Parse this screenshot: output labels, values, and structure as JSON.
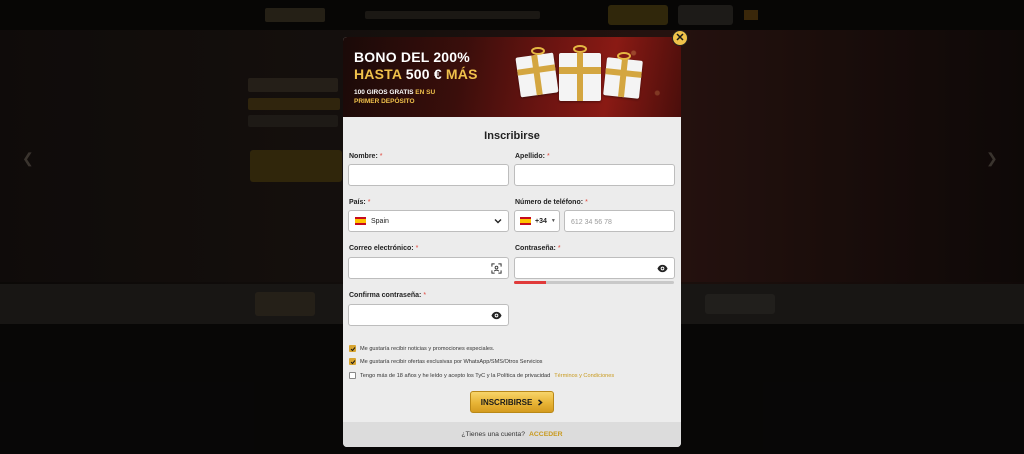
{
  "banner": {
    "title_line1": "BONO DEL 200%",
    "title_line2_prefix": "HASTA ",
    "title_line2_amount": "500 €",
    "title_line2_suffix": " MÁS",
    "sub_line1_prefix": "100 GIROS GRATIS",
    "sub_line1_suffix": " EN SU",
    "sub_line2": "PRIMER DEPÓSITO"
  },
  "close_icon": "close-icon",
  "form": {
    "title": "Inscribirse",
    "required_mark": "*",
    "first_name": {
      "label": "Nombre:",
      "value": ""
    },
    "last_name": {
      "label": "Apellido:",
      "value": ""
    },
    "country": {
      "label": "País:",
      "value": "Spain"
    },
    "phone": {
      "label": "Número de teléfono:",
      "code": "+34",
      "placeholder": "612 34 56 78"
    },
    "email": {
      "label": "Correo electrónico:",
      "value": ""
    },
    "password": {
      "label": "Contraseña:",
      "value": "",
      "strength": 0.2
    },
    "confirm_password": {
      "label": "Confirma contraseña:",
      "value": ""
    },
    "checkboxes": [
      {
        "text": "Me gustaría recibir noticias y promociones especiales.",
        "checked": true
      },
      {
        "text": "Me gustaría recibir ofertas exclusivas por WhatsApp/SMS/Otros Servicios",
        "checked": true
      },
      {
        "text": "Tengo más de 18 años y he leído y acepto los TyC y la Política de privacidad",
        "link": "Términos y Condiciones",
        "checked": false
      }
    ],
    "submit_label": "INSCRIBIRSE",
    "footer_text": "¿Tienes una cuenta?",
    "footer_link": "ACCEDER"
  },
  "colors": {
    "accent_gold": "#f0c14b",
    "banner_red": "#6b1411",
    "error_red": "#e03a3a"
  }
}
